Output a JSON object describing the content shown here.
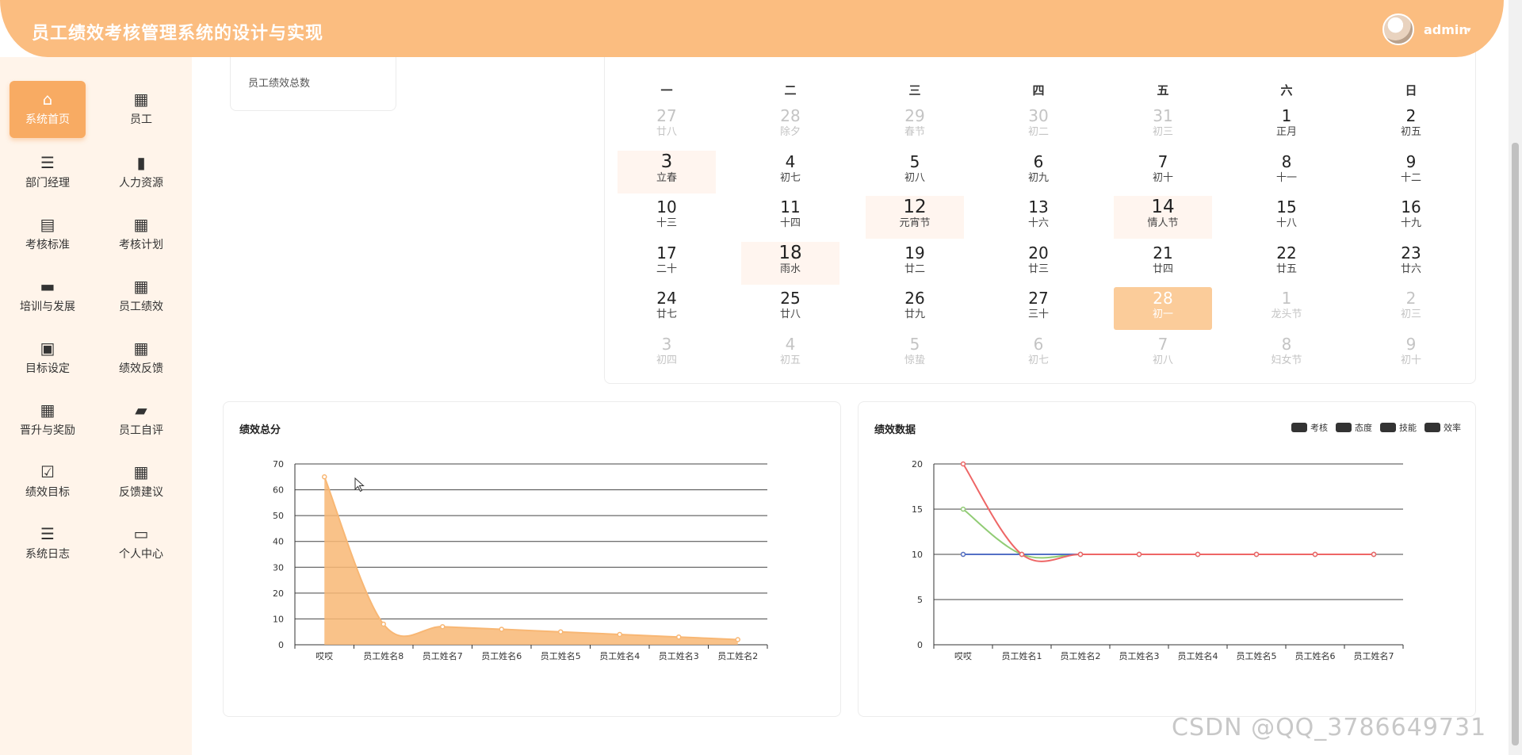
{
  "header": {
    "title": "员工绩效考核管理系统的设计与实现",
    "user": "admin",
    "caret": "▾"
  },
  "sidebar": {
    "items": [
      {
        "key": "home",
        "label": "系统首页",
        "icon": "⌂",
        "active": true
      },
      {
        "key": "employee",
        "label": "员工",
        "icon": "▦",
        "active": false
      },
      {
        "key": "manager",
        "label": "部门经理",
        "icon": "☰",
        "active": false
      },
      {
        "key": "hr",
        "label": "人力资源",
        "icon": "▮",
        "active": false
      },
      {
        "key": "standard",
        "label": "考核标准",
        "icon": "▤",
        "active": false
      },
      {
        "key": "plan",
        "label": "考核计划",
        "icon": "▦",
        "active": false
      },
      {
        "key": "training",
        "label": "培训与发展",
        "icon": "▬",
        "active": false
      },
      {
        "key": "performance",
        "label": "员工绩效",
        "icon": "▦",
        "active": false
      },
      {
        "key": "goal",
        "label": "目标设定",
        "icon": "▣",
        "active": false
      },
      {
        "key": "feedback",
        "label": "绩效反馈",
        "icon": "▦",
        "active": false
      },
      {
        "key": "promotion",
        "label": "晋升与奖励",
        "icon": "▦",
        "active": false
      },
      {
        "key": "selfeval",
        "label": "员工自评",
        "icon": "▰",
        "active": false
      },
      {
        "key": "target",
        "label": "绩效目标",
        "icon": "☑",
        "active": false
      },
      {
        "key": "suggestion",
        "label": "反馈建议",
        "icon": "▦",
        "active": false
      },
      {
        "key": "log",
        "label": "系统日志",
        "icon": "☰",
        "active": false
      },
      {
        "key": "personal",
        "label": "个人中心",
        "icon": "▭",
        "active": false
      }
    ]
  },
  "stat": {
    "label": "员工绩效总数"
  },
  "calendar": {
    "weekdays": [
      "一",
      "二",
      "三",
      "四",
      "五",
      "六",
      "日"
    ],
    "weeks": [
      [
        {
          "d": "27",
          "l": "廿八",
          "o": true
        },
        {
          "d": "28",
          "l": "除夕",
          "o": true
        },
        {
          "d": "29",
          "l": "春节",
          "o": true
        },
        {
          "d": "30",
          "l": "初二",
          "o": true
        },
        {
          "d": "31",
          "l": "初三",
          "o": true
        },
        {
          "d": "1",
          "l": "正月"
        },
        {
          "d": "2",
          "l": "初五"
        }
      ],
      [
        {
          "d": "3",
          "l": "立春",
          "h": true
        },
        {
          "d": "4",
          "l": "初七"
        },
        {
          "d": "5",
          "l": "初八"
        },
        {
          "d": "6",
          "l": "初九"
        },
        {
          "d": "7",
          "l": "初十"
        },
        {
          "d": "8",
          "l": "十一"
        },
        {
          "d": "9",
          "l": "十二"
        }
      ],
      [
        {
          "d": "10",
          "l": "十三"
        },
        {
          "d": "11",
          "l": "十四"
        },
        {
          "d": "12",
          "l": "元宵节",
          "h": true
        },
        {
          "d": "13",
          "l": "十六"
        },
        {
          "d": "14",
          "l": "情人节",
          "h": true
        },
        {
          "d": "15",
          "l": "十八"
        },
        {
          "d": "16",
          "l": "十九"
        }
      ],
      [
        {
          "d": "17",
          "l": "二十"
        },
        {
          "d": "18",
          "l": "雨水",
          "h": true
        },
        {
          "d": "19",
          "l": "廿二"
        },
        {
          "d": "20",
          "l": "廿三"
        },
        {
          "d": "21",
          "l": "廿四"
        },
        {
          "d": "22",
          "l": "廿五"
        },
        {
          "d": "23",
          "l": "廿六"
        }
      ],
      [
        {
          "d": "24",
          "l": "廿七"
        },
        {
          "d": "25",
          "l": "廿八"
        },
        {
          "d": "26",
          "l": "廿九"
        },
        {
          "d": "27",
          "l": "三十"
        },
        {
          "d": "28",
          "l": "初一",
          "t": true
        },
        {
          "d": "1",
          "l": "龙头节",
          "o": true
        },
        {
          "d": "2",
          "l": "初三",
          "o": true
        }
      ],
      [
        {
          "d": "3",
          "l": "初四",
          "o": true
        },
        {
          "d": "4",
          "l": "初五",
          "o": true
        },
        {
          "d": "5",
          "l": "惊蛰",
          "o": true
        },
        {
          "d": "6",
          "l": "初七",
          "o": true
        },
        {
          "d": "7",
          "l": "初八",
          "o": true
        },
        {
          "d": "8",
          "l": "妇女节",
          "o": true
        },
        {
          "d": "9",
          "l": "初十",
          "o": true
        }
      ]
    ]
  },
  "chart_data": [
    {
      "type": "area",
      "title": "绩效总分",
      "categories": [
        "哎哎",
        "员工姓名8",
        "员工姓名7",
        "员工姓名6",
        "员工姓名5",
        "员工姓名4",
        "员工姓名3",
        "员工姓名2"
      ],
      "values": [
        65,
        8,
        7,
        6,
        5,
        4,
        3,
        2
      ],
      "ylim": [
        0,
        70
      ],
      "yticks": [
        0,
        10,
        20,
        30,
        40,
        50,
        60,
        70
      ],
      "grid": true,
      "color": "#f8b774"
    },
    {
      "type": "line",
      "title": "绩效数据",
      "categories": [
        "哎哎",
        "员工姓名1",
        "员工姓名2",
        "员工姓名3",
        "员工姓名4",
        "员工姓名5",
        "员工姓名6",
        "员工姓名7"
      ],
      "series": [
        {
          "name": "考核",
          "values": [
            10,
            10,
            10,
            10,
            10,
            10,
            10,
            10
          ],
          "color": "#f2c55c"
        },
        {
          "name": "态度",
          "values": [
            15,
            10,
            10,
            10,
            10,
            10,
            10,
            10
          ],
          "color": "#91cc75"
        },
        {
          "name": "技能",
          "values": [
            10,
            10,
            10,
            10,
            10,
            10,
            10,
            10
          ],
          "color": "#5470c6"
        },
        {
          "name": "效率",
          "values": [
            20,
            10,
            10,
            10,
            10,
            10,
            10,
            10
          ],
          "color": "#ee6666"
        }
      ],
      "ylim": [
        0,
        20
      ],
      "yticks": [
        0,
        5,
        10,
        15,
        20
      ],
      "grid": true,
      "legend_position": "top-right"
    }
  ],
  "watermark": "CSDN @QQ_3786649731"
}
